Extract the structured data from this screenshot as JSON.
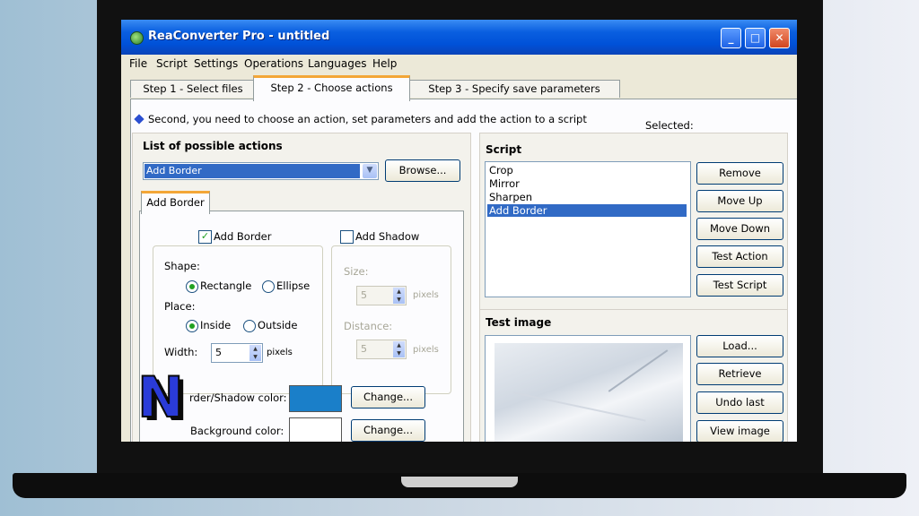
{
  "window": {
    "title": "ReaConverter Pro - untitled",
    "minimize": "_",
    "maximize": "□",
    "close": "✕",
    "app_icon": "reaconverter-icon"
  },
  "menu": [
    "File",
    "Script",
    "Settings",
    "Operations",
    "Languages",
    "Help"
  ],
  "tabs": [
    {
      "label": "Step 1 - Select files",
      "active": false
    },
    {
      "label": "Step 2 - Choose actions",
      "active": true
    },
    {
      "label": "Step 3 - Specify save parameters",
      "active": false
    }
  ],
  "hint": "Second, you need to choose an action, set parameters and add the action to a script",
  "selected_label": "Selected:",
  "actions": {
    "title": "List of possible actions",
    "selected": "Add Border",
    "browse": "Browse...",
    "subtab": "Add Border",
    "add_border": {
      "label": "Add Border",
      "checked": true
    },
    "add_shadow": {
      "label": "Add Shadow",
      "checked": false
    },
    "shape_label": "Shape:",
    "shape_options": [
      "Rectangle",
      "Ellipse"
    ],
    "shape_selected": "Rectangle",
    "place_label": "Place:",
    "place_options": [
      "Inside",
      "Outside"
    ],
    "place_selected": "Inside",
    "width_label": "Width:",
    "width_value": "5",
    "pixels": "pixels",
    "size_label": "Size:",
    "size_value": "5",
    "distance_label": "Distance:",
    "distance_value": "5",
    "border_color_label": "rder/Shadow color:",
    "border_color": "#1a7fc9",
    "background_color_label": "Background color:",
    "background_color": "#ffffff",
    "change": "Change..."
  },
  "script": {
    "title": "Script",
    "items": [
      "Crop",
      "Mirror",
      "Sharpen",
      "Add Border"
    ],
    "selected": "Add Border",
    "buttons": [
      "Remove",
      "Move Up",
      "Move Down",
      "Test Action",
      "Test Script"
    ]
  },
  "test_image": {
    "title": "Test image",
    "buttons": [
      "Load...",
      "Retrieve",
      "Undo last",
      "View image"
    ]
  },
  "overlay_logo": {
    "letter": "N",
    "fill": "#2a3bd8",
    "shadow": "#0a0a0a"
  }
}
